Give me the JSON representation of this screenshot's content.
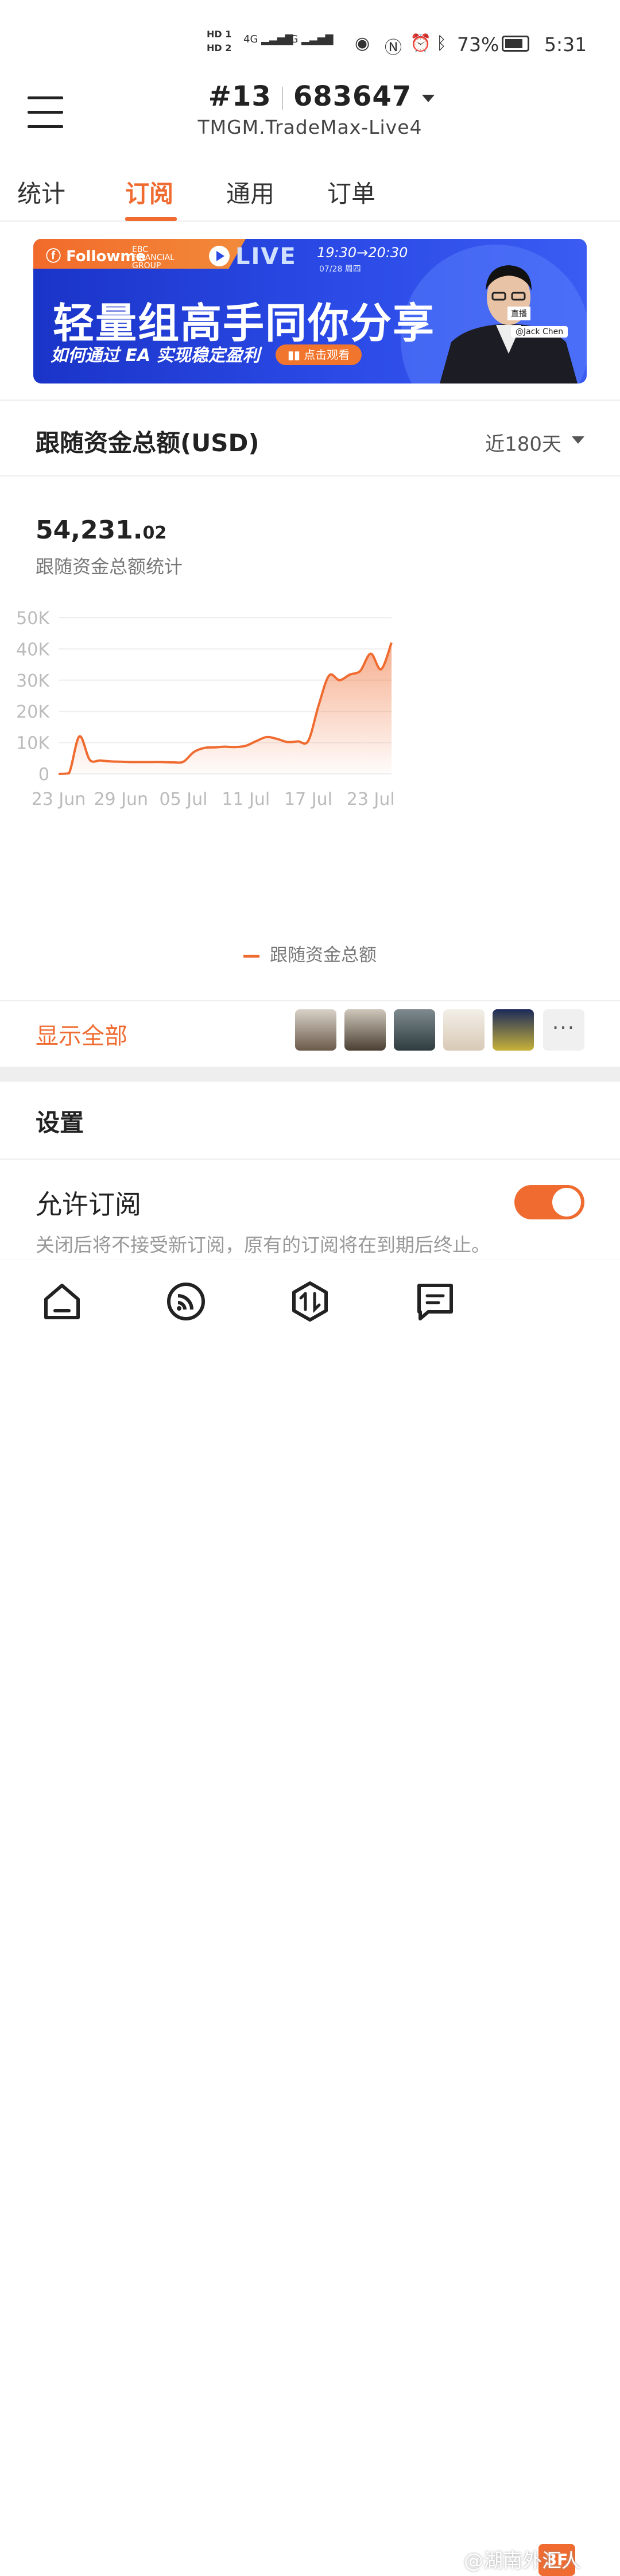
{
  "status": {
    "hd1": "HD 1",
    "hd2": "HD 2",
    "sig1": "4G",
    "sig2": "4G",
    "battery": "73%",
    "time": "5:31"
  },
  "header": {
    "rank": "#13",
    "account": "683647",
    "server": "TMGM.TradeMax-Live4"
  },
  "tabs": [
    "统计",
    "订阅",
    "通用",
    "订单"
  ],
  "active_tab": 1,
  "banner": {
    "brand": "Followme",
    "partner": "EBC FINANCIAL GROUP",
    "live": "LIVE",
    "time": "19:30→20:30",
    "date": "07/28 周四",
    "headline": "轻量组高手同你分享",
    "sub": "如何通过 EA 实现稳定盈利",
    "cta": "点击观看",
    "badge": "直播",
    "host": "@Jack Chen"
  },
  "card": {
    "title": "跟随资金总额(USD)",
    "range": "近180天",
    "total_int": "54,231.",
    "total_dec": "02",
    "total_label": "跟随资金总额统计",
    "show_all": "显示全部",
    "more": "···"
  },
  "chart_data": {
    "type": "area",
    "x_ticks": [
      "23 Jun",
      "29 Jun",
      "05 Jul",
      "11 Jul",
      "17 Jul",
      "23 Jul"
    ],
    "y_ticks": [
      "0",
      "10K",
      "20K",
      "30K",
      "40K",
      "50K"
    ],
    "ylim": [
      0,
      50000
    ],
    "color": "#ef6b30",
    "series": [
      {
        "name": "跟随资金总额",
        "x": [
          "2022-06-23",
          "2022-06-24",
          "2022-06-25",
          "2022-06-26",
          "2022-06-27",
          "2022-06-28",
          "2022-06-29",
          "2022-06-30",
          "2022-07-01",
          "2022-07-02",
          "2022-07-03",
          "2022-07-04",
          "2022-07-05",
          "2022-07-06",
          "2022-07-07",
          "2022-07-08",
          "2022-07-09",
          "2022-07-10",
          "2022-07-11",
          "2022-07-12",
          "2022-07-13",
          "2022-07-14",
          "2022-07-15",
          "2022-07-16",
          "2022-07-17",
          "2022-07-18",
          "2022-07-19",
          "2022-07-20",
          "2022-07-21",
          "2022-07-22",
          "2022-07-23",
          "2022-07-24",
          "2022-07-25"
        ],
        "values": [
          0,
          200,
          12000,
          4500,
          4300,
          4000,
          3900,
          3800,
          3800,
          3800,
          3800,
          3700,
          3900,
          7000,
          8300,
          8500,
          8700,
          8600,
          9000,
          10500,
          11800,
          11200,
          10200,
          10400,
          10600,
          22000,
          31500,
          30000,
          31800,
          33000,
          38500,
          33500,
          42000
        ]
      }
    ],
    "grid": true,
    "legend": "bottom-center"
  },
  "settings": {
    "title": "设置",
    "allow_label": "允许订阅",
    "allow_desc": "关闭后将不接受新订阅，原有的订阅将在到期后终止。",
    "allow_on": true
  },
  "nav": {
    "watermark": "@湖南外汇人",
    "badge": "3F"
  }
}
